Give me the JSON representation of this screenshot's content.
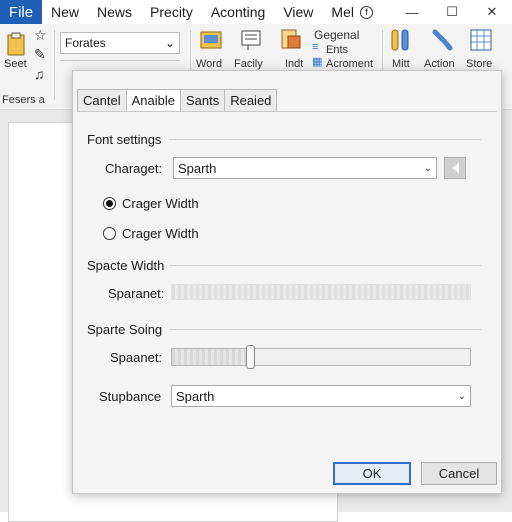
{
  "menubar": {
    "items": [
      "File",
      "New",
      "News",
      "Precity",
      "Aconting",
      "View",
      "Mel"
    ],
    "window_controls": [
      "—",
      "☐",
      "✕"
    ]
  },
  "ribbon": {
    "font_combo": "Forates",
    "labels": {
      "seet": "Seet",
      "fesers": "Fesers a",
      "word": "Word",
      "facily": "Facily",
      "indt": "Indt",
      "gegenal": "Gegenal",
      "ents": "Ents",
      "acroment": "Acroment",
      "mitt": "Mitt",
      "action": "Action",
      "store": "Store"
    }
  },
  "dialog": {
    "tabs": [
      "Cantel",
      "Anaible",
      "Sants",
      "Reaied"
    ],
    "active_tab": 1,
    "font_settings": {
      "title": "Font settings",
      "charaget_label": "Charaget:",
      "charaget_value": "Sparth",
      "radio_1": "Crager Width",
      "radio_2": "Crager Width",
      "radio_selected": 1
    },
    "spacte_width": {
      "title": "Spacte Width",
      "label": "Sparanet:",
      "value": 0
    },
    "sparte_soing": {
      "title": "Sparte Soing",
      "label": "Spaanet:",
      "value": 0.26
    },
    "stupbance": {
      "label": "Stupbance",
      "value": "Sparth"
    },
    "buttons": {
      "ok": "OK",
      "cancel": "Cancel"
    }
  },
  "colors": {
    "accent": "#1f5fb8",
    "default_button_border": "#2d6fd0"
  }
}
